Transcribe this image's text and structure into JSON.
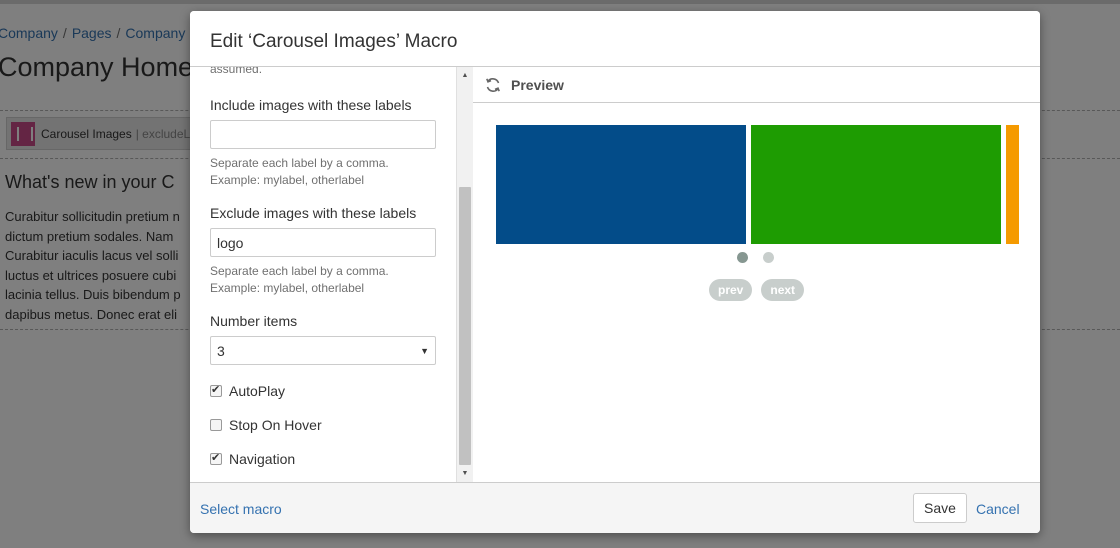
{
  "background": {
    "breadcrumb": [
      "Company",
      "Pages",
      "Company"
    ],
    "page_title": "Company Home",
    "macro_placeholder": {
      "label": "Carousel Images",
      "param": "| excludeL"
    },
    "heading": "What's new in your C",
    "paragraph_lines": [
      "Curabitur sollicitudin pretium n",
      "dictum pretium sodales. Nam",
      "Curabitur iaculis lacus vel solli",
      "luctus et ultrices posuere cubi",
      "lacinia tellus. Duis bibendum p",
      "dapibus metus. Donec erat eli"
    ]
  },
  "dialog": {
    "title": "Edit ‘Carousel Images’ Macro",
    "left": {
      "cut_text": "assumed.",
      "include": {
        "label": "Include images with these labels",
        "value": "",
        "help_lines": [
          "Separate each label by a comma.",
          "Example: mylabel, otherlabel"
        ]
      },
      "exclude": {
        "label": "Exclude images with these labels",
        "value": "logo",
        "help_lines": [
          "Separate each label by a comma.",
          "Example: mylabel, otherlabel"
        ]
      },
      "number_items": {
        "label": "Number items",
        "value": "3"
      },
      "checkboxes": [
        {
          "label": "AutoPlay",
          "checked": true
        },
        {
          "label": "Stop On Hover",
          "checked": false
        },
        {
          "label": "Navigation",
          "checked": true
        }
      ]
    },
    "preview": {
      "label": "Preview",
      "slide_colors": [
        "#034c89",
        "#1e9c02",
        "#f59a00"
      ],
      "dots": 2,
      "active_dot": 0,
      "prev_label": "prev",
      "next_label": "next"
    },
    "footer": {
      "select_macro": "Select macro",
      "save": "Save",
      "cancel": "Cancel"
    }
  }
}
